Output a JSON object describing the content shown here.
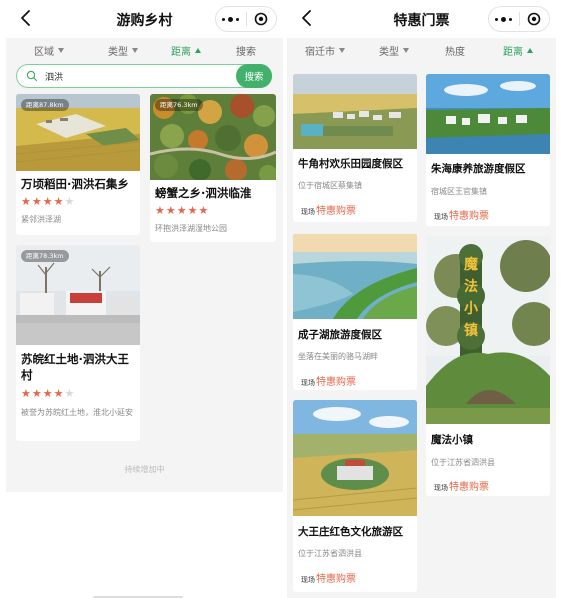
{
  "left": {
    "title": "游购乡村",
    "filters": [
      {
        "label": "区域",
        "indicator": "down",
        "active": false
      },
      {
        "label": "类型",
        "indicator": "down",
        "active": false
      },
      {
        "label": "距离",
        "indicator": "up",
        "active": true
      },
      {
        "label": "搜索",
        "indicator": "none",
        "active": false
      }
    ],
    "search": {
      "value": "泗洪",
      "button": "搜索"
    },
    "cards": [
      {
        "distance": "距离87.8km",
        "title": "万顷稻田·泗洪石集乡",
        "rating": 4,
        "desc": "紧邻洪泽湖"
      },
      {
        "distance": "距离76.3km",
        "title": "螃蟹之乡·泗洪临淮",
        "rating": 5,
        "desc": "环抱洪泽湖湿地公园"
      },
      {
        "distance": "距离78.3km",
        "title": "苏皖红土地·泗洪大王村",
        "rating": 4,
        "desc": "被誉为苏皖红土地，淮北小延安"
      }
    ],
    "loading_more": "持续增加中"
  },
  "right": {
    "title": "特惠门票",
    "filters": [
      {
        "label": "宿迁市",
        "indicator": "down",
        "active": false
      },
      {
        "label": "类型",
        "indicator": "down",
        "active": false
      },
      {
        "label": "热度",
        "indicator": "none",
        "active": false
      },
      {
        "label": "距离",
        "indicator": "up",
        "active": true
      }
    ],
    "cards": [
      {
        "title": "牛角村欢乐田园度假区",
        "desc": "位于宿城区蔡集镇",
        "ticket_prefix": "现场",
        "ticket_label": "特惠购票"
      },
      {
        "title": "朱海康养旅游度假区",
        "desc": "宿城区王官集镇",
        "ticket_prefix": "现场",
        "ticket_label": "特惠购票"
      },
      {
        "title": "成子湖旅游度假区",
        "desc": "坐落在美丽的骆马湖畔",
        "ticket_prefix": "现场",
        "ticket_label": "特惠购票"
      },
      {
        "title": "魔法小镇",
        "desc": "位于江苏省泗洪县",
        "ticket_prefix": "现场",
        "ticket_label": "特惠购票",
        "image_sign": "魔法小镇"
      },
      {
        "title": "大王庄红色文化旅游区",
        "desc": "位于江苏省泗洪县",
        "ticket_prefix": "现场",
        "ticket_label": "特惠购票"
      }
    ]
  },
  "colors": {
    "accent": "#41b16c",
    "ticket": "#e5664a",
    "star_on": "#e5664a",
    "star_off": "#d6d6d6"
  },
  "icons": {
    "back": "chevron-left-icon",
    "more": "more-dots-icon",
    "target": "target-icon",
    "search": "search-icon"
  }
}
